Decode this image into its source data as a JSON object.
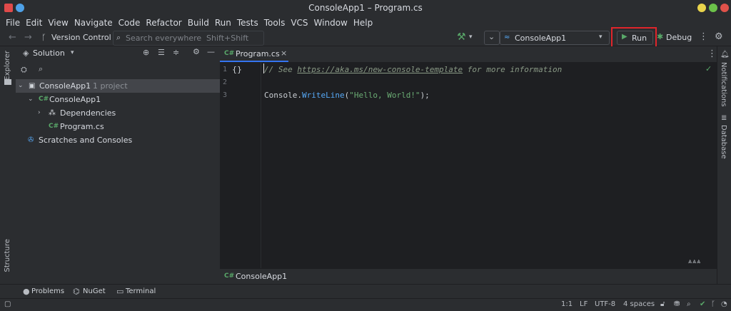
{
  "window": {
    "title": "ConsoleApp1 – Program.cs"
  },
  "menu": [
    "File",
    "Edit",
    "View",
    "Navigate",
    "Code",
    "Refactor",
    "Build",
    "Run",
    "Tests",
    "Tools",
    "VCS",
    "Window",
    "Help"
  ],
  "toolbar": {
    "version_control": "Version Control",
    "search_placeholder": "Search everywhere",
    "search_shortcut": "Shift+Shift",
    "config": "ConsoleApp1",
    "run": "Run",
    "debug": "Debug"
  },
  "left_strip": {
    "explorer": "Explorer",
    "structure": "Structure"
  },
  "project_panel": {
    "title": "Solution",
    "tree": [
      {
        "label": "ConsoleApp1",
        "suffix": " · 1 project"
      },
      {
        "label": "ConsoleApp1"
      },
      {
        "label": "Dependencies"
      },
      {
        "label": "Program.cs"
      },
      {
        "label": "Scratches and Consoles"
      }
    ]
  },
  "editor": {
    "tab": "Program.cs",
    "lines": [
      "1",
      "2",
      "3"
    ],
    "code": {
      "comment_start": "// See ",
      "url": "https://aka.ms/new-console-template",
      "comment_end": " for more information",
      "console": "Console",
      "dot": ".",
      "method": "WriteLine",
      "open": "(",
      "string": "\"Hello, World!\"",
      "close": ");"
    },
    "breadcrumb": "ConsoleApp1"
  },
  "right_strip": {
    "notifications": "Notifications",
    "database": "Database"
  },
  "bottom_tabs": {
    "problems": "Problems",
    "nuget": "NuGet",
    "terminal": "Terminal"
  },
  "status": {
    "position": "1:1",
    "line_ending": "LF",
    "encoding": "UTF-8",
    "indent": "4 spaces"
  },
  "colors": {
    "accent_red": "#e0252b",
    "run_green": "#59a869",
    "link_blue": "#56a8f5"
  }
}
